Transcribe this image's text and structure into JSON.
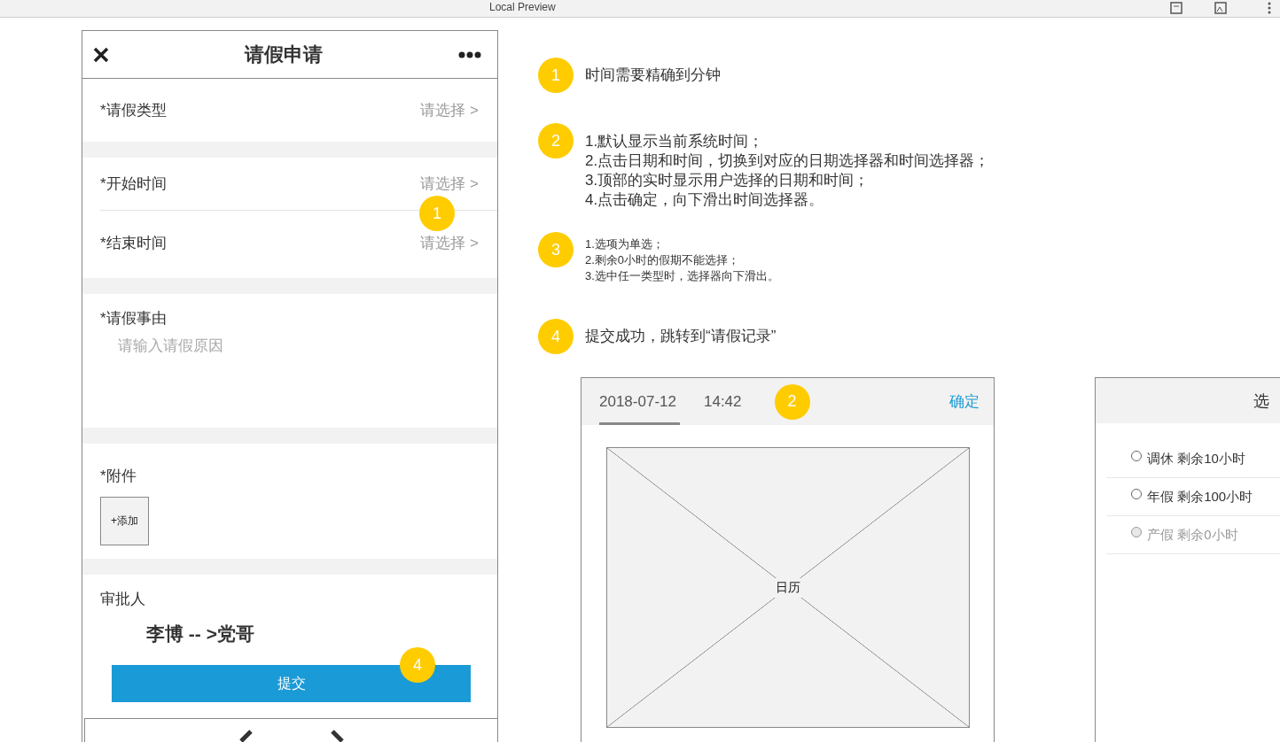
{
  "window": {
    "title": "Local Preview"
  },
  "phone": {
    "title": "请假申请",
    "type_row": {
      "label": "*请假类型",
      "value": "请选择 >"
    },
    "time_rows": [
      {
        "label": "*开始时间",
        "value": "请选择 >",
        "marker": "1"
      },
      {
        "label": "*结束时间",
        "value": "请选择 >"
      }
    ],
    "reason": {
      "label": "*请假事由",
      "placeholder": "请输入请假原因"
    },
    "attachment": {
      "label": "*附件",
      "add_button": "+添加"
    },
    "approver": {
      "label": "审批人",
      "chain": "李博 -- >党哥",
      "marker": "4"
    },
    "submit_button": "提交"
  },
  "notes": [
    {
      "number": "1",
      "kind": "normal",
      "lines": [
        "时间需要精确到分钟"
      ]
    },
    {
      "number": "2",
      "kind": "normal",
      "lines": [
        "1.默认显示当前系统时间；",
        "2.点击日期和时间，切换到对应的日期选择器和时间选择器；",
        "3.顶部的实时显示用户选择的日期和时间；",
        "4.点击确定，向下滑出时间选择器。"
      ]
    },
    {
      "number": "3",
      "kind": "small",
      "lines": [
        "1.选项为单选；",
        "2.剩余0小时的假期不能选择；",
        "3.选中任一类型时，选择器向下滑出。"
      ]
    },
    {
      "number": "4",
      "kind": "normal",
      "lines": [
        "提交成功，跳转到“请假记录”"
      ]
    }
  ],
  "date_picker": {
    "tabs": [
      {
        "label": "2018-07-12",
        "selected": true
      },
      {
        "label": "14:42",
        "selected": false
      }
    ],
    "marker": "2",
    "confirm": "确定",
    "calendar_label": "日历"
  },
  "type_picker": {
    "title": "选",
    "options": [
      {
        "label": "调休 剩余10小时",
        "selected": false,
        "disabled": false
      },
      {
        "label": "年假 剩余100小时",
        "selected": false,
        "disabled": false
      },
      {
        "label": "产假 剩余0小时",
        "selected": false,
        "disabled": true
      }
    ]
  }
}
